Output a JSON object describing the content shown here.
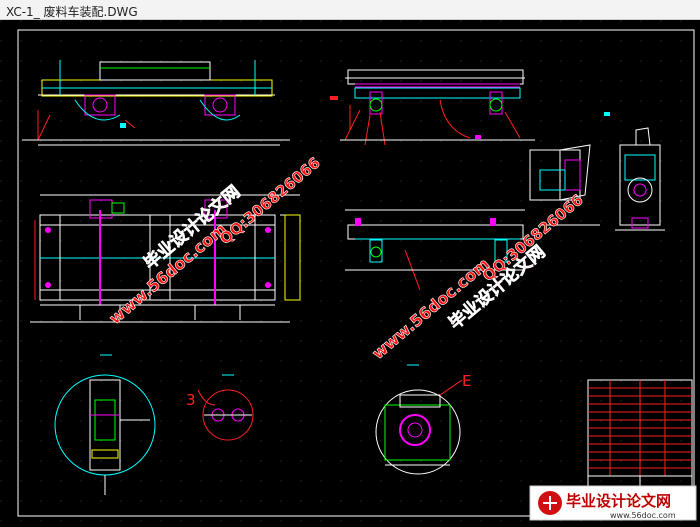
{
  "window": {
    "title": "XC-1_ 废料车装配.DWG"
  },
  "drawing": {
    "label_e": "E",
    "label_3": "3",
    "watermarks": [
      {
        "text": "毕业设计论文网"
      },
      {
        "text": "www.56doc.com"
      },
      {
        "text": "QQ:306826066"
      }
    ],
    "stamp": {
      "text": "毕业设计论文网",
      "url": "www.56doc.com"
    }
  },
  "colors": {
    "background": "#000000",
    "frame": "#ffffff",
    "magenta": "#ff00ff",
    "cyan": "#00ffff",
    "red": "#ff2020",
    "green": "#00ff00",
    "yellow": "#ffff00",
    "watermark_red": "#ff1010"
  }
}
